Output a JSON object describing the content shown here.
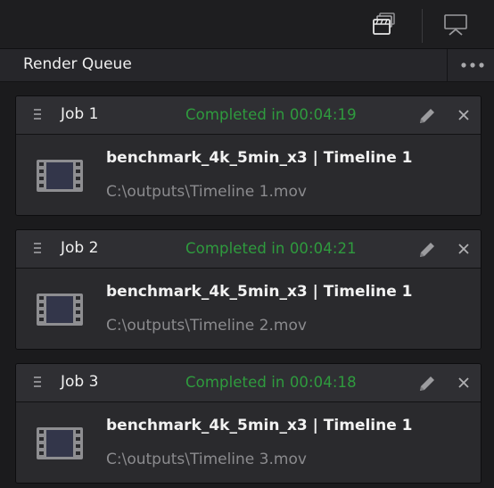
{
  "toolbar": {
    "icons": [
      "render-cache-icon",
      "output-display-icon"
    ]
  },
  "panel": {
    "title": "Render Queue",
    "more_icon": "more-options-icon"
  },
  "jobs": [
    {
      "name": "Job 1",
      "status": "Completed in 00:04:19",
      "title": "benchmark_4k_5min_x3 | Timeline 1",
      "path": "C:\\outputs\\Timeline 1.mov"
    },
    {
      "name": "Job 2",
      "status": "Completed in 00:04:21",
      "title": "benchmark_4k_5min_x3 | Timeline 1",
      "path": "C:\\outputs\\Timeline 2.mov"
    },
    {
      "name": "Job 3",
      "status": "Completed in 00:04:18",
      "title": "benchmark_4k_5min_x3 | Timeline 1",
      "path": "C:\\outputs\\Timeline 3.mov"
    }
  ],
  "colors": {
    "status_completed": "#2f9b3e",
    "background": "#1b1b1d",
    "card": "#2b2b2e"
  }
}
